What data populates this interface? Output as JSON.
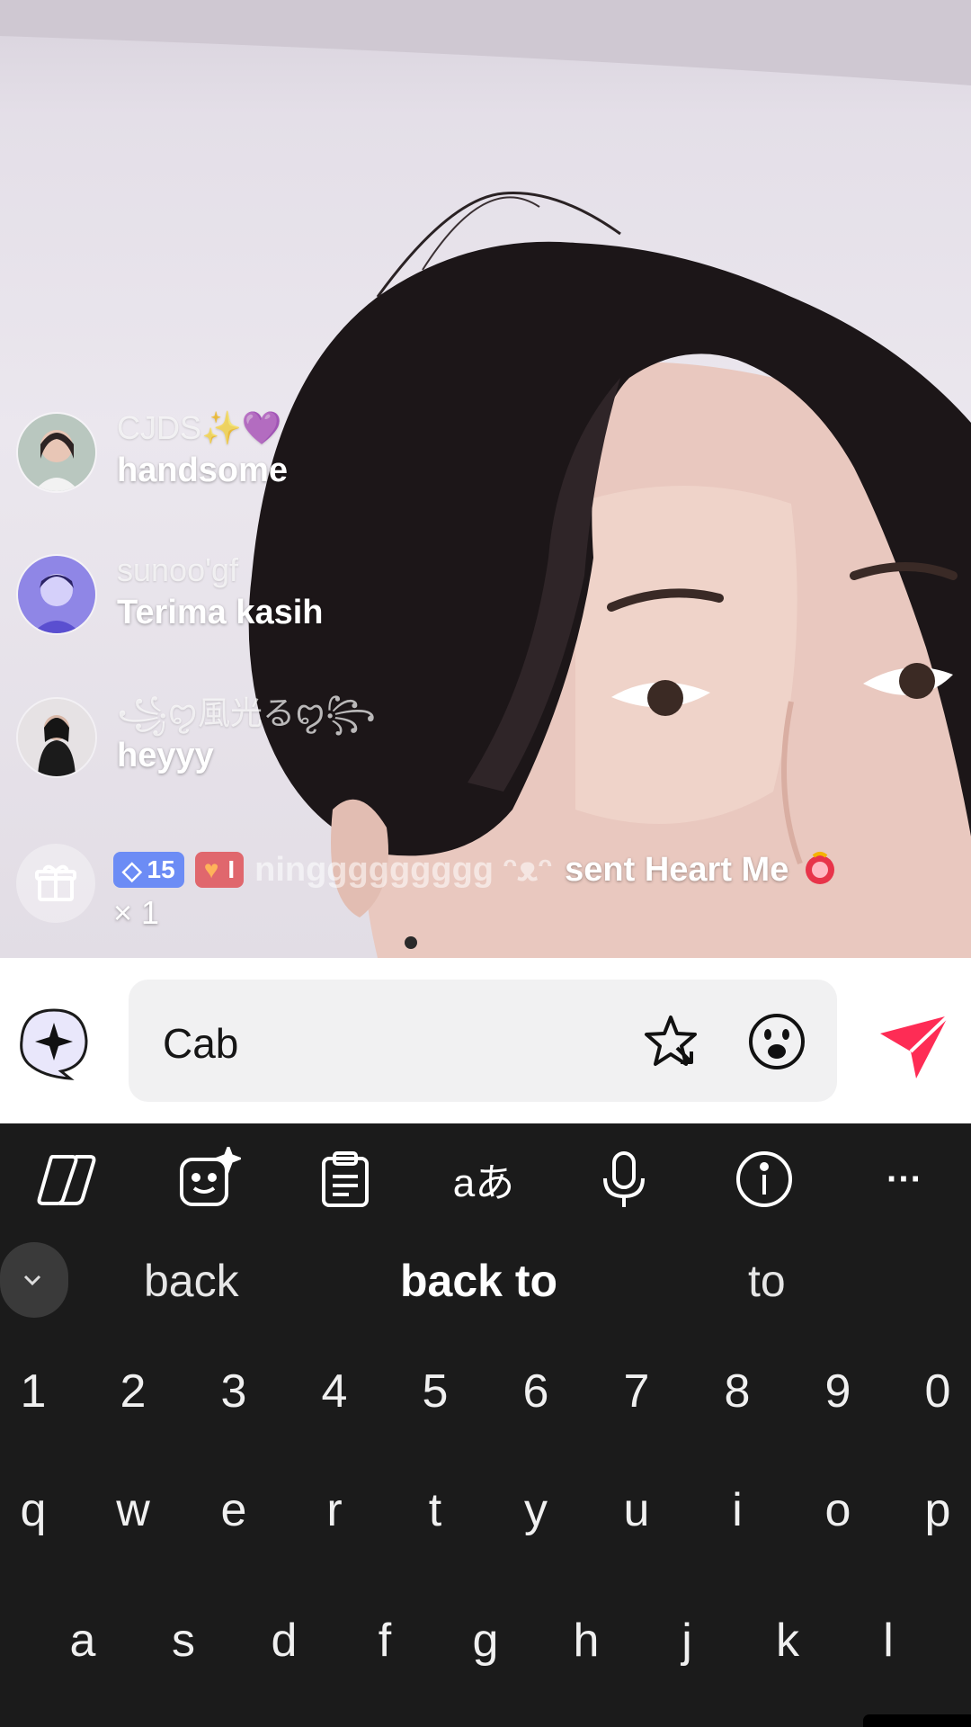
{
  "comments": [
    {
      "username": "CJDS✨💜",
      "message": "handsome"
    },
    {
      "username": "sunoo'gf",
      "message": "Terima kasih"
    },
    {
      "username": "꧁ꨄ風光るꨄ꧂",
      "message": "heyyy"
    }
  ],
  "gift": {
    "level_badge": "15",
    "fan_badge": "I",
    "username": "ninggggggggg ᵔᴥᵔ",
    "text": "sent Heart Me",
    "count": "× 1"
  },
  "input": {
    "value": "Cab",
    "send_color": "#fe2c55"
  },
  "keyboard": {
    "toolbar_icons": [
      "copilot-icon",
      "sticker-icon",
      "clipboard-icon",
      "translate-icon",
      "mic-icon",
      "info-icon",
      "more-icon"
    ],
    "translate_glyph": "aあ",
    "more_glyph": "···",
    "suggestions": [
      "back",
      "back to",
      "to"
    ],
    "number_row": [
      "1",
      "2",
      "3",
      "4",
      "5",
      "6",
      "7",
      "8",
      "9",
      "0"
    ],
    "row1": [
      "q",
      "w",
      "e",
      "r",
      "t",
      "y",
      "u",
      "i",
      "o",
      "p"
    ],
    "row2": [
      "a",
      "s",
      "d",
      "f",
      "g",
      "h",
      "j",
      "k",
      "l"
    ]
  }
}
